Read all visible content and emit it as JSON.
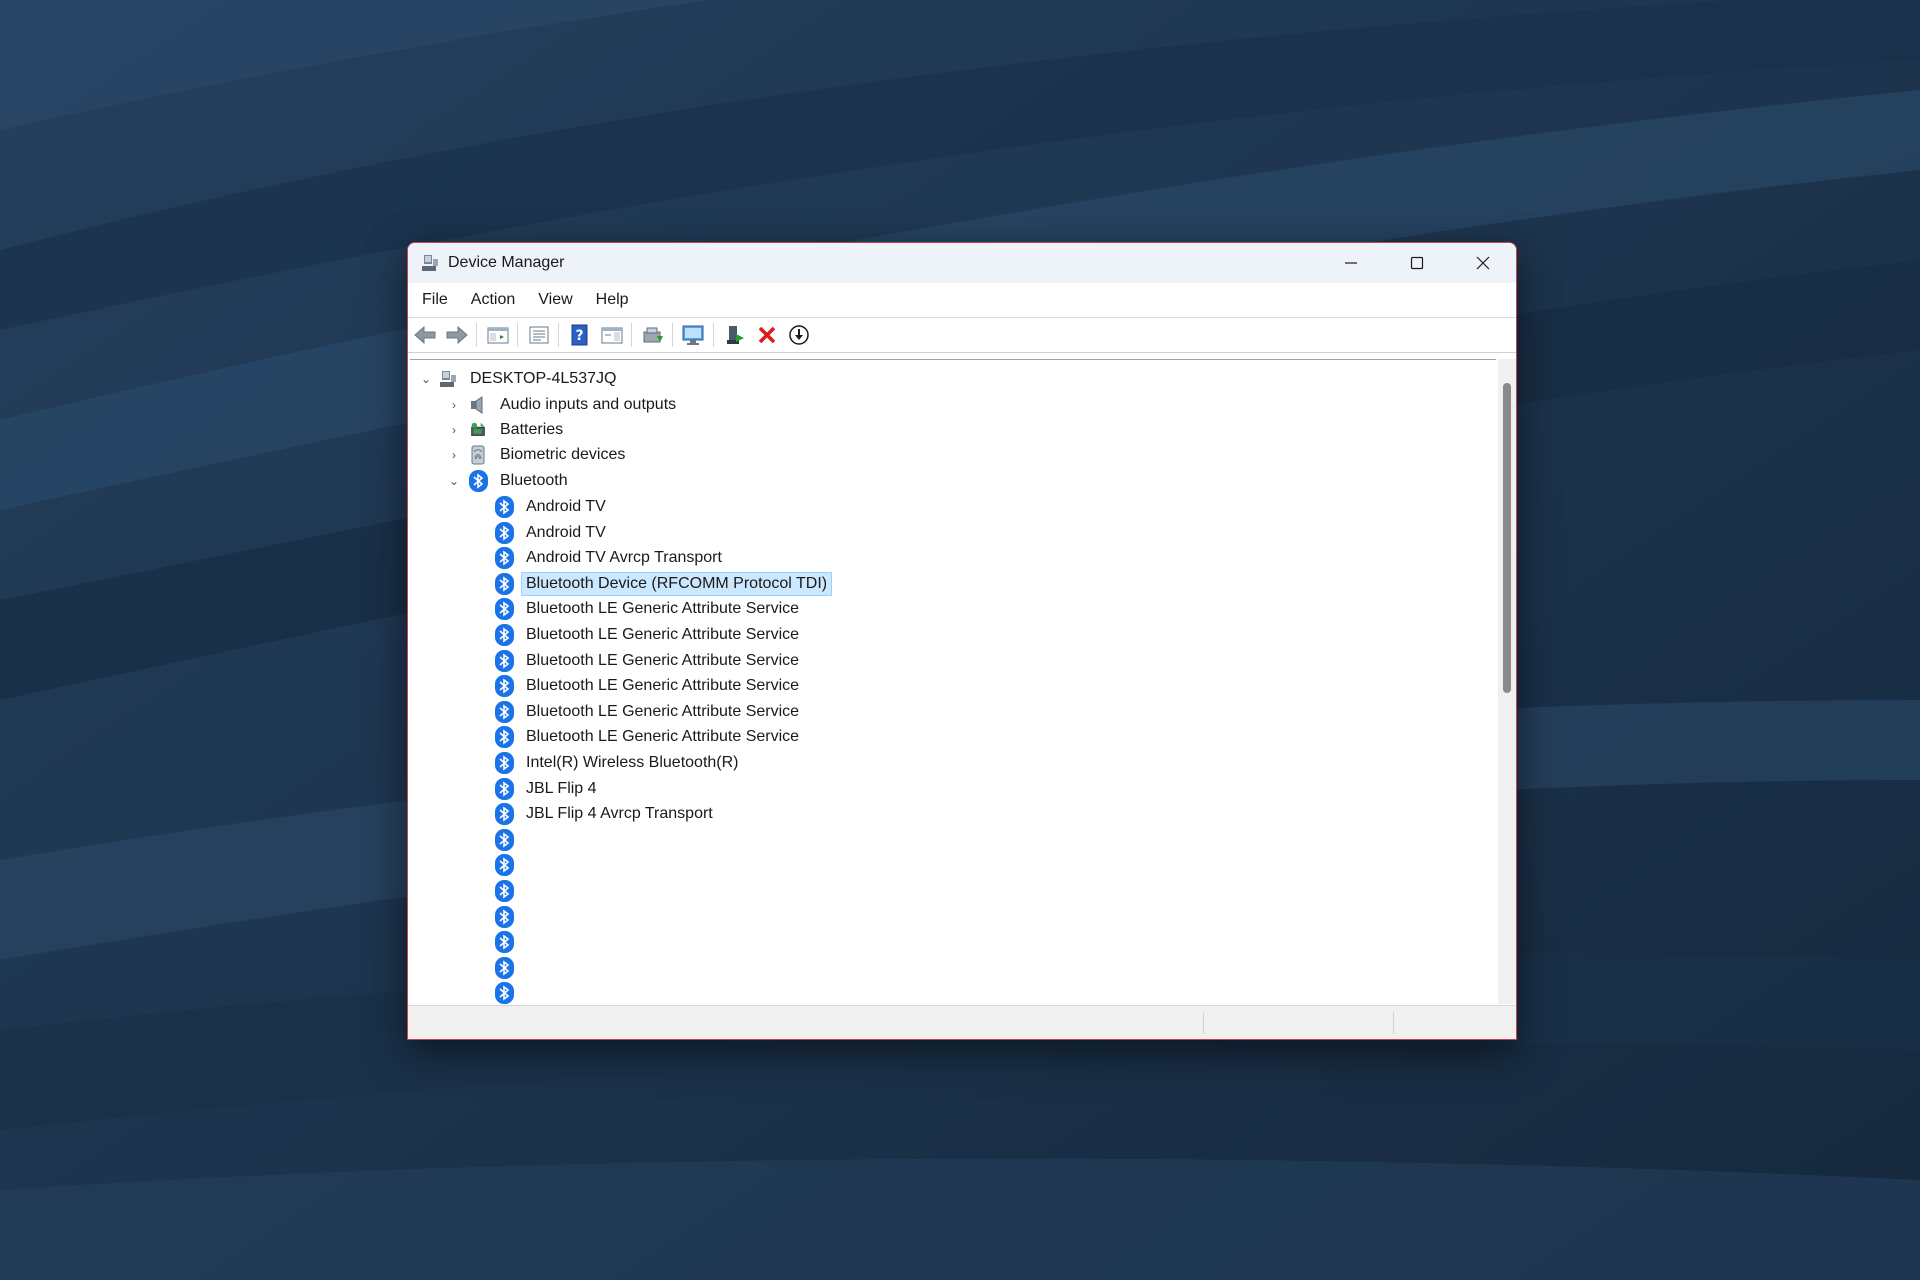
{
  "window": {
    "title": "Device Manager",
    "accent_border": "#c8434f"
  },
  "window_controls": {
    "minimize_icon": "minimize-icon",
    "maximize_icon": "maximize-icon",
    "close_icon": "close-icon"
  },
  "menu": {
    "items": [
      "File",
      "Action",
      "View",
      "Help"
    ]
  },
  "toolbar": {
    "buttons": [
      "back-arrow-icon",
      "forward-arrow-icon",
      "show-hide-console-tree-icon",
      "properties-icon",
      "help-icon",
      "action-pane-icon",
      "update-driver-icon",
      "scan-hardware-icon",
      "enable-device-icon",
      "uninstall-device-icon",
      "disable-device-icon"
    ]
  },
  "tree": {
    "root": {
      "label": "DESKTOP-4L537JQ",
      "expanded": true
    },
    "categories": [
      {
        "label": "Audio inputs and outputs",
        "expanded": false,
        "icon": "speaker-icon"
      },
      {
        "label": "Batteries",
        "expanded": false,
        "icon": "battery-icon"
      },
      {
        "label": "Biometric devices",
        "expanded": false,
        "icon": "fingerprint-icon"
      },
      {
        "label": "Bluetooth",
        "expanded": true,
        "icon": "bluetooth-icon"
      }
    ],
    "bluetooth_devices": [
      "Android TV",
      "Android TV",
      "Android TV Avrcp Transport",
      "Bluetooth Device (RFCOMM Protocol TDI)",
      "Bluetooth LE Generic Attribute Service",
      "Bluetooth LE Generic Attribute Service",
      "Bluetooth LE Generic Attribute Service",
      "Bluetooth LE Generic Attribute Service",
      "Bluetooth LE Generic Attribute Service",
      "Bluetooth LE Generic Attribute Service",
      "Intel(R) Wireless Bluetooth(R)",
      "JBL Flip 4",
      "JBL Flip 4 Avrcp Transport",
      "",
      "",
      "",
      "",
      "",
      "",
      ""
    ],
    "selected": "Bluetooth Device (RFCOMM Protocol TDI)"
  },
  "colors": {
    "bluetooth": "#1a74e8",
    "selection_bg": "#cce8ff",
    "wallpaper": "#1f3752"
  }
}
